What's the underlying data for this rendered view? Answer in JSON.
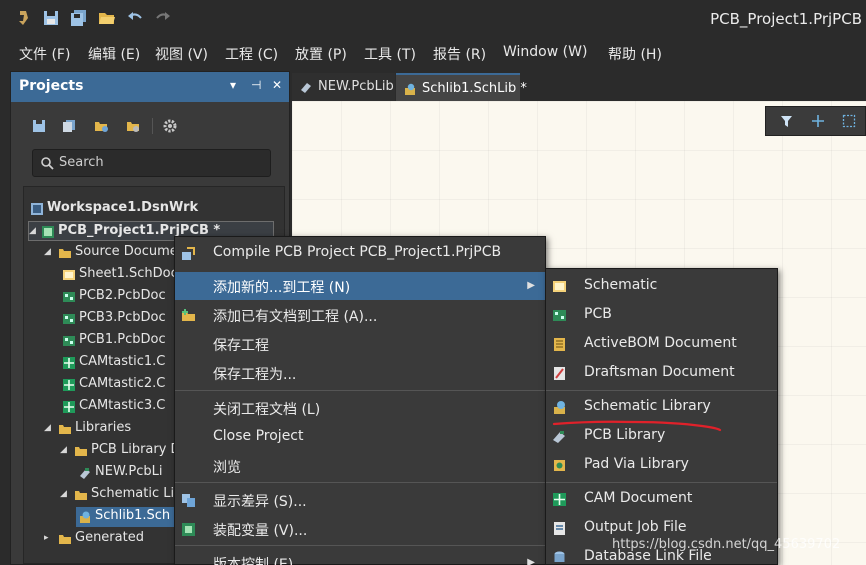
{
  "window": {
    "title": "PCB_Project1.PrjPCB"
  },
  "titlebar_icons": [
    "app-logo-icon",
    "save-icon",
    "save-all-icon",
    "open-folder-icon",
    "undo-icon",
    "redo-icon"
  ],
  "menubar": [
    "文件 (F)",
    "编辑 (E)",
    "视图 (V)",
    "工程 (C)",
    "放置 (P)",
    "工具 (T)",
    "报告 (R)",
    "Window (W)",
    "帮助 (H)"
  ],
  "panel": {
    "title": "Projects",
    "controls": [
      "▾",
      "⊣",
      "✕"
    ],
    "search_placeholder": "Search",
    "tree": [
      {
        "label": "Workspace1.DsnWrk",
        "bold": true
      },
      {
        "label": "PCB_Project1.PrjPCB *",
        "bold": true
      },
      {
        "label": "Source Docume"
      },
      {
        "label": "Sheet1.SchDoc"
      },
      {
        "label": "PCB2.PcbDoc"
      },
      {
        "label": "PCB3.PcbDoc"
      },
      {
        "label": "PCB1.PcbDoc"
      },
      {
        "label": "CAMtastic1.C"
      },
      {
        "label": "CAMtastic2.C"
      },
      {
        "label": "CAMtastic3.C"
      },
      {
        "label": "Libraries"
      },
      {
        "label": "PCB Library D"
      },
      {
        "label": "NEW.PcbLi"
      },
      {
        "label": "Schematic Lib"
      },
      {
        "label": "Schlib1.Sch"
      },
      {
        "label": "Generated"
      }
    ]
  },
  "tabs": [
    {
      "label": "NEW.PcbLib",
      "active": false
    },
    {
      "label": "Schlib1.SchLib *",
      "active": true
    }
  ],
  "context_menu": [
    {
      "label": "Compile PCB Project PCB_Project1.PrjPCB",
      "icon": "compile-icon"
    },
    {
      "label": "添加新的...到工程 (N)",
      "icon": "",
      "submenu": true,
      "active": true
    },
    {
      "label": "添加已有文档到工程 (A)...",
      "icon": "add-doc-icon"
    },
    {
      "label": "保存工程",
      "icon": ""
    },
    {
      "label": "保存工程为...",
      "icon": ""
    },
    {
      "label": "关闭工程文档 (L)",
      "icon": ""
    },
    {
      "label": "Close Project",
      "icon": ""
    },
    {
      "label": "浏览",
      "icon": ""
    },
    {
      "label": "显示差异 (S)...",
      "icon": "diff-icon"
    },
    {
      "label": "装配变量 (V)...",
      "icon": "variant-icon"
    },
    {
      "label": "版本控制 (E)",
      "icon": "",
      "submenu": true
    }
  ],
  "submenu": [
    {
      "label": "Schematic",
      "icon": "schematic-icon"
    },
    {
      "label": "PCB",
      "icon": "pcb-icon"
    },
    {
      "label": "ActiveBOM Document",
      "icon": "bom-icon"
    },
    {
      "label": "Draftsman Document",
      "icon": "draftsman-icon"
    },
    {
      "label": "Schematic Library",
      "icon": "schlib-icon"
    },
    {
      "label": "PCB Library",
      "icon": "pcblib-icon"
    },
    {
      "label": "Pad Via Library",
      "icon": "padvia-icon"
    },
    {
      "label": "CAM Document",
      "icon": "cam-icon"
    },
    {
      "label": "Output Job File",
      "icon": "outjob-icon"
    },
    {
      "label": "Database Link File",
      "icon": "dblink-icon"
    }
  ],
  "watermark": "https://blog.csdn.net/qq_45639702",
  "colors": {
    "accent": "#3c6a96",
    "canvas": "#fbf8ef",
    "annotation": "#e0212a"
  }
}
